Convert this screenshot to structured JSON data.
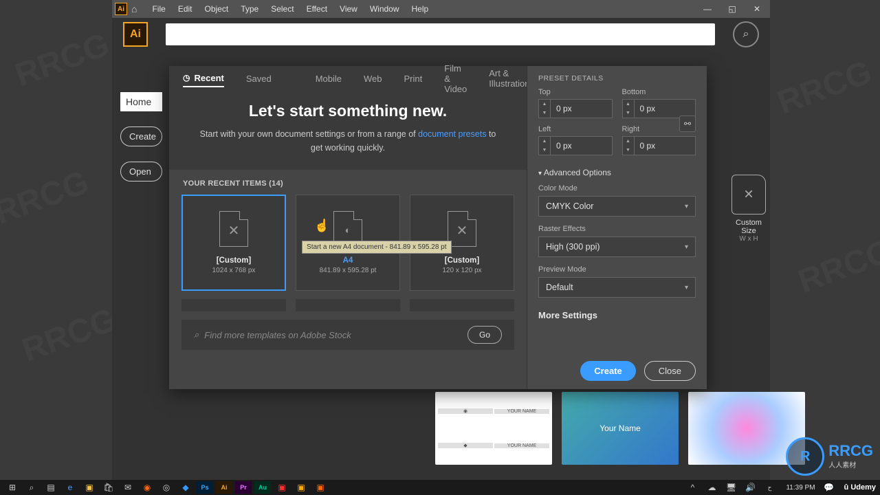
{
  "menu": {
    "items": [
      "File",
      "Edit",
      "Object",
      "Type",
      "Select",
      "Effect",
      "View",
      "Window",
      "Help"
    ]
  },
  "leftPanel": {
    "home": "Home",
    "create": "Create",
    "open": "Open"
  },
  "dialog": {
    "tabs": {
      "recent": "Recent",
      "saved": "Saved",
      "mobile": "Mobile",
      "web": "Web",
      "print": "Print",
      "film": "Film & Video",
      "art": "Art & Illustration"
    },
    "introTitle": "Let's start something new.",
    "introText1": "Start with your own document settings or from a range of ",
    "introLink": "document presets",
    "introText2": " to get working quickly.",
    "recentLabel": "YOUR RECENT ITEMS  (14)",
    "cards": [
      {
        "title": "[Custom]",
        "sub": "1024 x 768 px"
      },
      {
        "title": "A4",
        "sub": "841.89 x 595.28 pt",
        "tooltip": "Start a new A4 document - 841.89 x 595.28 pt"
      },
      {
        "title": "[Custom]",
        "sub": "120 x 120 px"
      }
    ],
    "stockPlaceholder": "Find more templates on Adobe Stock",
    "goLabel": "Go"
  },
  "preset": {
    "title": "PRESET DETAILS",
    "topLabel": "Top",
    "bottomLabel": "Bottom",
    "leftLabel": "Left",
    "rightLabel": "Right",
    "top": "0 px",
    "bottom": "0 px",
    "left": "0 px",
    "right": "0 px",
    "advanced": "Advanced Options",
    "colorModeLabel": "Color Mode",
    "colorMode": "CMYK Color",
    "rasterLabel": "Raster Effects",
    "raster": "High (300 ppi)",
    "previewLabel": "Preview Mode",
    "preview": "Default",
    "moreSettings": "More Settings",
    "create": "Create",
    "close": "Close"
  },
  "customSize": {
    "label": "Custom Size",
    "sub": "W x H"
  },
  "templates": {
    "name": "Your Name",
    "name2": "YOUR NAME"
  },
  "taskbar": {
    "time": "11:39 PM",
    "udemy": "Udemy"
  },
  "watermark": {
    "rrcg": "RRCG",
    "sub": "人人素材"
  }
}
